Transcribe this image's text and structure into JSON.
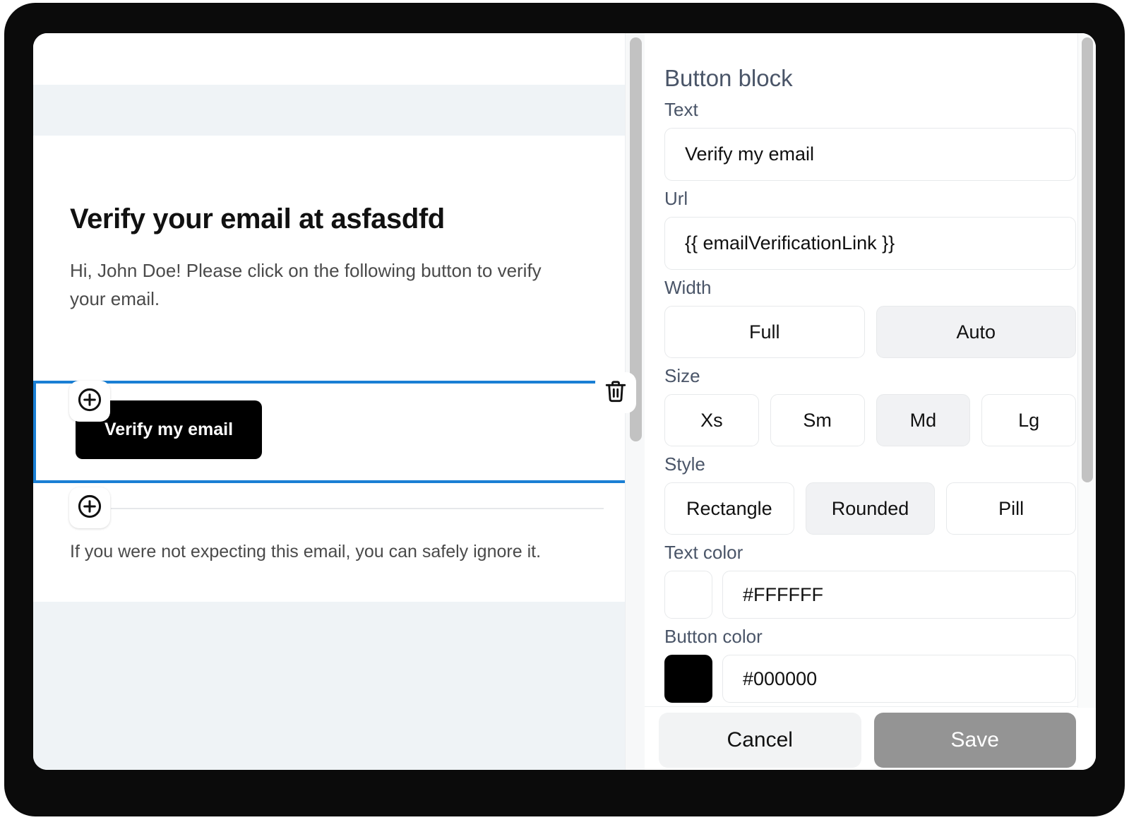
{
  "email_preview": {
    "heading": "Verify your email at asfasdfd",
    "paragraph": "Hi, John Doe! Please click on the following button to verify your email.",
    "action_button_label": "Verify my email",
    "footer_note": "If you were not expecting this email, you can safely ignore it.",
    "selection_color": "#1a7fd4",
    "icons": {
      "add_block": "plus-circle-icon",
      "delete_block": "trash-icon"
    }
  },
  "settings_panel": {
    "title": "Button block",
    "fields": {
      "text_label": "Text",
      "text_value": "Verify my email",
      "url_label": "Url",
      "url_value": "{{ emailVerificationLink }}",
      "width_label": "Width",
      "size_label": "Size",
      "style_label": "Style",
      "text_color_label": "Text color",
      "text_color_value": "#FFFFFF",
      "button_color_label": "Button color",
      "button_color_value": "#000000"
    },
    "width_options": [
      {
        "label": "Full",
        "selected": false
      },
      {
        "label": "Auto",
        "selected": true
      }
    ],
    "size_options": [
      {
        "label": "Xs",
        "selected": false
      },
      {
        "label": "Sm",
        "selected": false
      },
      {
        "label": "Md",
        "selected": true
      },
      {
        "label": "Lg",
        "selected": false
      }
    ],
    "style_options": [
      {
        "label": "Rectangle",
        "selected": false
      },
      {
        "label": "Rounded",
        "selected": true
      },
      {
        "label": "Pill",
        "selected": false
      }
    ],
    "footer": {
      "cancel_label": "Cancel",
      "save_label": "Save"
    }
  }
}
